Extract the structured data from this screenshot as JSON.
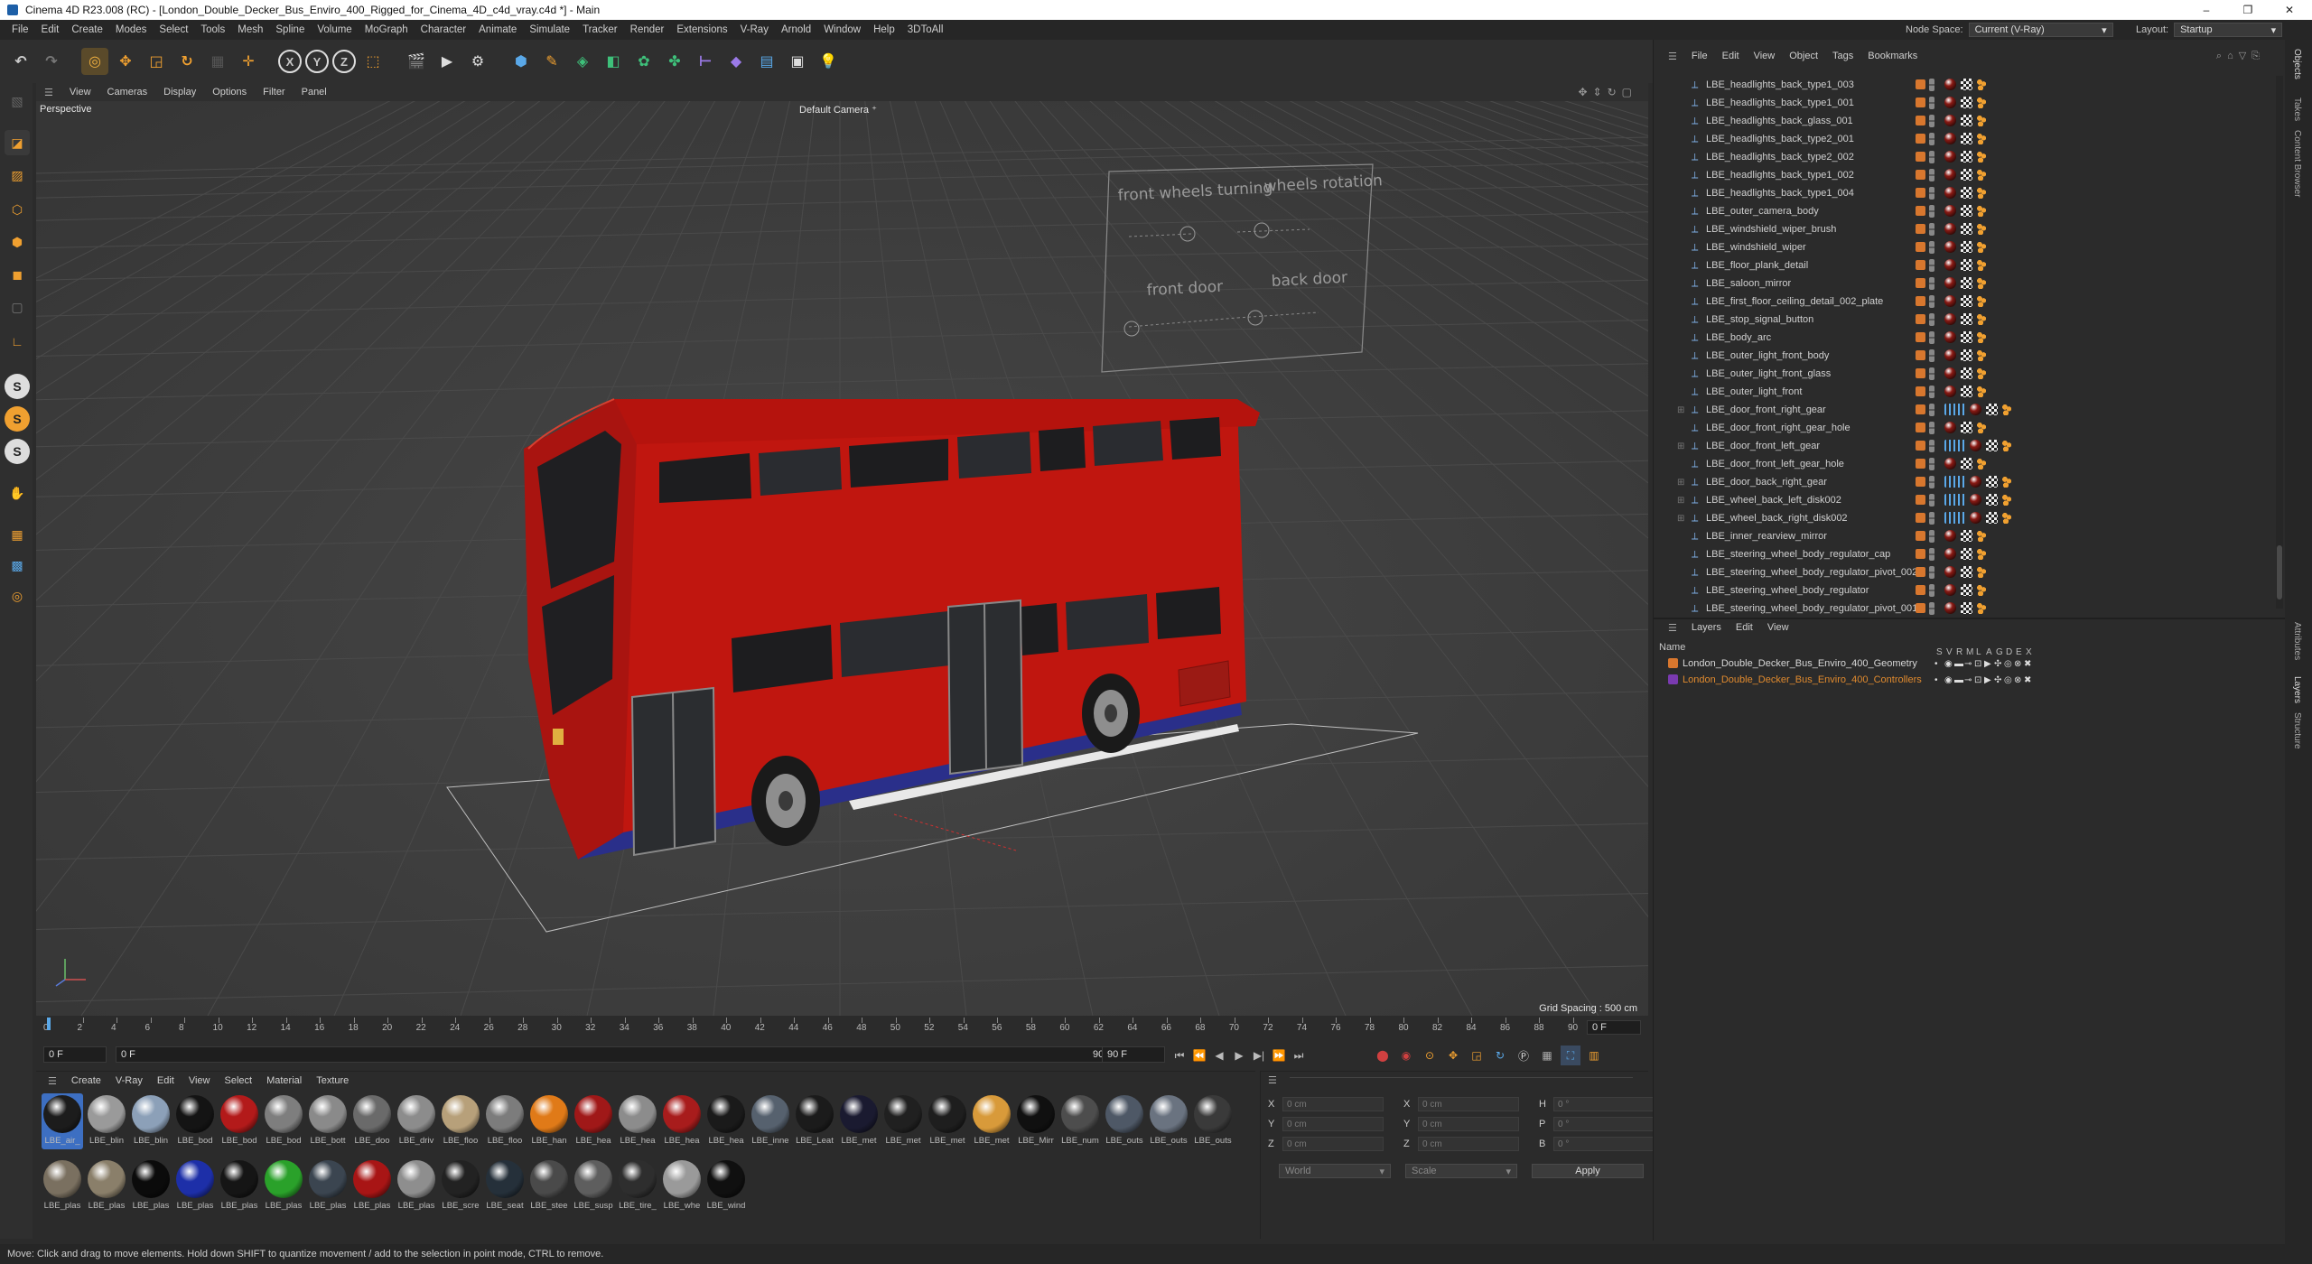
{
  "window": {
    "title": "Cinema 4D R23.008 (RC) - [London_Double_Decker_Bus_Enviro_400_Rigged_for_Cinema_4D_c4d_vray.c4d *] - Main",
    "controls": [
      "–",
      "❐",
      "✕"
    ]
  },
  "menubar": {
    "items": [
      "File",
      "Edit",
      "Create",
      "Modes",
      "Select",
      "Tools",
      "Mesh",
      "Spline",
      "Volume",
      "MoGraph",
      "Character",
      "Animate",
      "Simulate",
      "Tracker",
      "Render",
      "Extensions",
      "V-Ray",
      "Arnold",
      "Window",
      "Help",
      "3DToAll"
    ],
    "node_space_label": "Node Space:",
    "node_space_value": "Current (V-Ray)",
    "layout_label": "Layout:",
    "layout_value": "Startup"
  },
  "toolbar": {
    "axis_labels": [
      "X",
      "Y",
      "Z"
    ]
  },
  "viewport": {
    "menu": [
      "View",
      "Cameras",
      "Display",
      "Options",
      "Filter",
      "Panel"
    ],
    "view_name": "Perspective",
    "camera": "Default Camera",
    "grid_spacing": "Grid Spacing : 500 cm",
    "controller_labels": [
      "front wheels turning",
      "wheels rotation",
      "front door",
      "back door"
    ]
  },
  "timeline": {
    "ticks": [
      "0",
      "2",
      "4",
      "6",
      "8",
      "10",
      "12",
      "14",
      "16",
      "18",
      "20",
      "22",
      "24",
      "26",
      "28",
      "30",
      "32",
      "34",
      "36",
      "38",
      "40",
      "42",
      "44",
      "46",
      "48",
      "50",
      "52",
      "54",
      "56",
      "58",
      "60",
      "62",
      "64",
      "66",
      "68",
      "70",
      "72",
      "74",
      "76",
      "78",
      "80",
      "82",
      "84",
      "86",
      "88",
      "90"
    ],
    "current_frame_display": "0 F"
  },
  "transport": {
    "start_field": "0 F",
    "range_start": "0 F",
    "range_end": "90 F",
    "end_field": "90 F"
  },
  "material_manager": {
    "menu": [
      "Create",
      "V-Ray",
      "Edit",
      "View",
      "Select",
      "Material",
      "Texture"
    ],
    "row1": [
      {
        "name": "LBE_air_",
        "color": "#1c1c1c"
      },
      {
        "name": "LBE_blin",
        "color": "#9a9a9a"
      },
      {
        "name": "LBE_blin",
        "color": "#8ca0b8"
      },
      {
        "name": "LBE_bod",
        "color": "#141414"
      },
      {
        "name": "LBE_bod",
        "color": "#b31a1a"
      },
      {
        "name": "LBE_bod",
        "color": "#7e7e7e"
      },
      {
        "name": "LBE_bott",
        "color": "#8a8a8a"
      },
      {
        "name": "LBE_doo",
        "color": "#6a6a6a"
      },
      {
        "name": "LBE_driv",
        "color": "#8c8c8c"
      },
      {
        "name": "LBE_floo",
        "color": "#b7a07a"
      },
      {
        "name": "LBE_floo",
        "color": "#7c7c7c"
      },
      {
        "name": "LBE_han",
        "color": "#e07a18"
      },
      {
        "name": "LBE_hea",
        "color": "#a01818"
      },
      {
        "name": "LBE_hea",
        "color": "#8c8c8c"
      },
      {
        "name": "LBE_hea",
        "color": "#a81c1c"
      },
      {
        "name": "LBE_hea",
        "color": "#1a1a1a"
      },
      {
        "name": "LBE_inne",
        "color": "#56616e"
      },
      {
        "name": "LBE_Leat",
        "color": "#1b1b1b"
      },
      {
        "name": "LBE_met",
        "color": "#1a1a30"
      },
      {
        "name": "LBE_met",
        "color": "#202020"
      },
      {
        "name": "LBE_met",
        "color": "#1e1e1e"
      },
      {
        "name": "LBE_met",
        "color": "#d89a3a"
      },
      {
        "name": "LBE_Mirr",
        "color": "#101010"
      },
      {
        "name": "LBE_num",
        "color": "#4d4d4d"
      },
      {
        "name": "LBE_outs",
        "color": "#4e5866"
      },
      {
        "name": "LBE_outs",
        "color": "#6a7380"
      },
      {
        "name": "LBE_outs",
        "color": "#3a3a3a"
      }
    ],
    "row2": [
      {
        "name": "LBE_plas",
        "color": "#7a7060"
      },
      {
        "name": "LBE_plas",
        "color": "#8a7f6a"
      },
      {
        "name": "LBE_plas",
        "color": "#0b0b0b"
      },
      {
        "name": "LBE_plas",
        "color": "#1d2fa8"
      },
      {
        "name": "LBE_plas",
        "color": "#151515"
      },
      {
        "name": "LBE_plas",
        "color": "#2aa12a"
      },
      {
        "name": "LBE_plas",
        "color": "#3b4550"
      },
      {
        "name": "LBE_plas",
        "color": "#a81515"
      },
      {
        "name": "LBE_plas",
        "color": "#8e8e8e"
      },
      {
        "name": "LBE_scre",
        "color": "#222222"
      },
      {
        "name": "LBE_seat",
        "color": "#25303a"
      },
      {
        "name": "LBE_stee",
        "color": "#4a4a4a"
      },
      {
        "name": "LBE_susp",
        "color": "#5e5e5e"
      },
      {
        "name": "LBE_tire_",
        "color": "#2e2e2e"
      },
      {
        "name": "LBE_whe",
        "color": "#9a9a9a"
      },
      {
        "name": "LBE_wind",
        "color": "#101010"
      }
    ]
  },
  "attributes": {
    "rows": [
      {
        "a": "X",
        "av": "0 cm",
        "b": "X",
        "bv": "0 cm",
        "c": "H",
        "cv": "0 °"
      },
      {
        "a": "Y",
        "av": "0 cm",
        "b": "Y",
        "bv": "0 cm",
        "c": "P",
        "cv": "0 °"
      },
      {
        "a": "Z",
        "av": "0 cm",
        "b": "Z",
        "bv": "0 cm",
        "c": "B",
        "cv": "0 °"
      }
    ],
    "coord_mode": "World",
    "scale_mode": "Scale",
    "apply_label": "Apply"
  },
  "object_manager": {
    "menu": [
      "File",
      "Edit",
      "View",
      "Object",
      "Tags",
      "Bookmarks"
    ],
    "objects": [
      {
        "name": "LBE_headlights_back_type1_003",
        "expandable": false
      },
      {
        "name": "LBE_headlights_back_type1_001",
        "expandable": false
      },
      {
        "name": "LBE_headlights_back_glass_001",
        "expandable": false
      },
      {
        "name": "LBE_headlights_back_type2_001",
        "expandable": false
      },
      {
        "name": "LBE_headlights_back_type2_002",
        "expandable": false
      },
      {
        "name": "LBE_headlights_back_type1_002",
        "expandable": false
      },
      {
        "name": "LBE_headlights_back_type1_004",
        "expandable": false
      },
      {
        "name": "LBE_outer_camera_body",
        "expandable": false
      },
      {
        "name": "LBE_windshield_wiper_brush",
        "expandable": false
      },
      {
        "name": "LBE_windshield_wiper",
        "expandable": false
      },
      {
        "name": "LBE_floor_plank_detail",
        "expandable": false
      },
      {
        "name": "LBE_saloon_mirror",
        "expandable": false
      },
      {
        "name": "LBE_first_floor_ceiling_detail_002_plate",
        "expandable": false
      },
      {
        "name": "LBE_stop_signal_button",
        "expandable": false
      },
      {
        "name": "LBE_body_arc",
        "expandable": false
      },
      {
        "name": "LBE_outer_light_front_body",
        "expandable": false
      },
      {
        "name": "LBE_outer_light_front_glass",
        "expandable": false
      },
      {
        "name": "LBE_outer_light_front",
        "expandable": false
      },
      {
        "name": "LBE_door_front_right_gear",
        "expandable": true
      },
      {
        "name": "LBE_door_front_right_gear_hole",
        "expandable": false
      },
      {
        "name": "LBE_door_front_left_gear",
        "expandable": true
      },
      {
        "name": "LBE_door_front_left_gear_hole",
        "expandable": false
      },
      {
        "name": "LBE_door_back_right_gear",
        "expandable": true
      },
      {
        "name": "LBE_wheel_back_left_disk002",
        "expandable": true
      },
      {
        "name": "LBE_wheel_back_right_disk002",
        "expandable": true
      },
      {
        "name": "LBE_inner_rearview_mirror",
        "expandable": false
      },
      {
        "name": "LBE_steering_wheel_body_regulator_cap",
        "expandable": false
      },
      {
        "name": "LBE_steering_wheel_body_regulator_pivot_002",
        "expandable": false
      },
      {
        "name": "LBE_steering_wheel_body_regulator",
        "expandable": false
      },
      {
        "name": "LBE_steering_wheel_body_regulator_pivot_001",
        "expandable": false
      }
    ]
  },
  "layers": {
    "menu": [
      "Layers",
      "Edit",
      "View"
    ],
    "header_name": "Name",
    "header_flags": [
      "S",
      "V",
      "R",
      "M",
      "L",
      "A",
      "G",
      "D",
      "E",
      "X"
    ],
    "items": [
      {
        "name": "London_Double_Decker_Bus_Enviro_400_Geometry",
        "color": "#d8772e"
      },
      {
        "name": "London_Double_Decker_Bus_Enviro_400_Controllers",
        "color": "#7a3ab0"
      }
    ]
  },
  "side_tabs": {
    "top": [
      "Objects",
      "Takes",
      "Content Browser"
    ],
    "bottom": [
      "Attributes",
      "Layers",
      "Structure"
    ]
  },
  "status": {
    "text": "Move: Click and drag to move elements. Hold down SHIFT to quantize movement / add to the selection in point mode, CTRL to remove."
  },
  "colors": {
    "accent": "#e08a2e",
    "bus_red": "#c0160f",
    "bus_blue": "#2a2f8a",
    "selection": "#3d6fc2"
  }
}
